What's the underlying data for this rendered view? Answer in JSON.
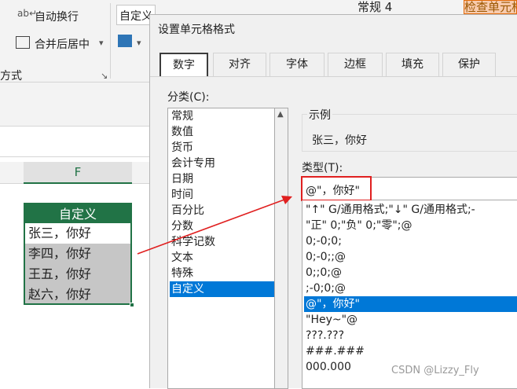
{
  "ribbon": {
    "wrap_text": "自动换行",
    "merge_center": "合并后居中",
    "section_label": "方式",
    "format_value": "自定义",
    "style_normal": "常规 4",
    "style_check": "检查单元格",
    "colors": {
      "excel_green": "#217346",
      "selection_blue": "#0078d7",
      "highlight_red": "#e02020"
    }
  },
  "sheet": {
    "column_header": "F",
    "cells": [
      "自定义",
      "张三，你好",
      "李四，你好",
      "王五，你好",
      "赵六，你好"
    ]
  },
  "dialog": {
    "title": "设置单元格格式",
    "tabs": [
      "数字",
      "对齐",
      "字体",
      "边框",
      "填充",
      "保护"
    ],
    "active_tab": "数字",
    "category_label": "分类(C):",
    "categories": [
      "常规",
      "数值",
      "货币",
      "会计专用",
      "日期",
      "时间",
      "百分比",
      "分数",
      "科学记数",
      "文本",
      "特殊",
      "自定义"
    ],
    "selected_category": "自定义",
    "sample_label": "示例",
    "sample_value": "张三，你好",
    "type_label": "类型(T):",
    "type_value": "@\"，你好\"",
    "formats": [
      "\"↑\" G/通用格式;\"↓\" G/通用格式;-",
      "\"正\" 0;\"负\" 0;\"零\";@",
      "0;-0;0;",
      "0;-0;;@",
      "0;;0;@",
      ";-0;0;@",
      "@\"，你好\"",
      "\"Hey~\"@",
      "???.???",
      "###.###",
      "000.000"
    ]
  },
  "watermark": "CSDN @Lizzy_Fly"
}
